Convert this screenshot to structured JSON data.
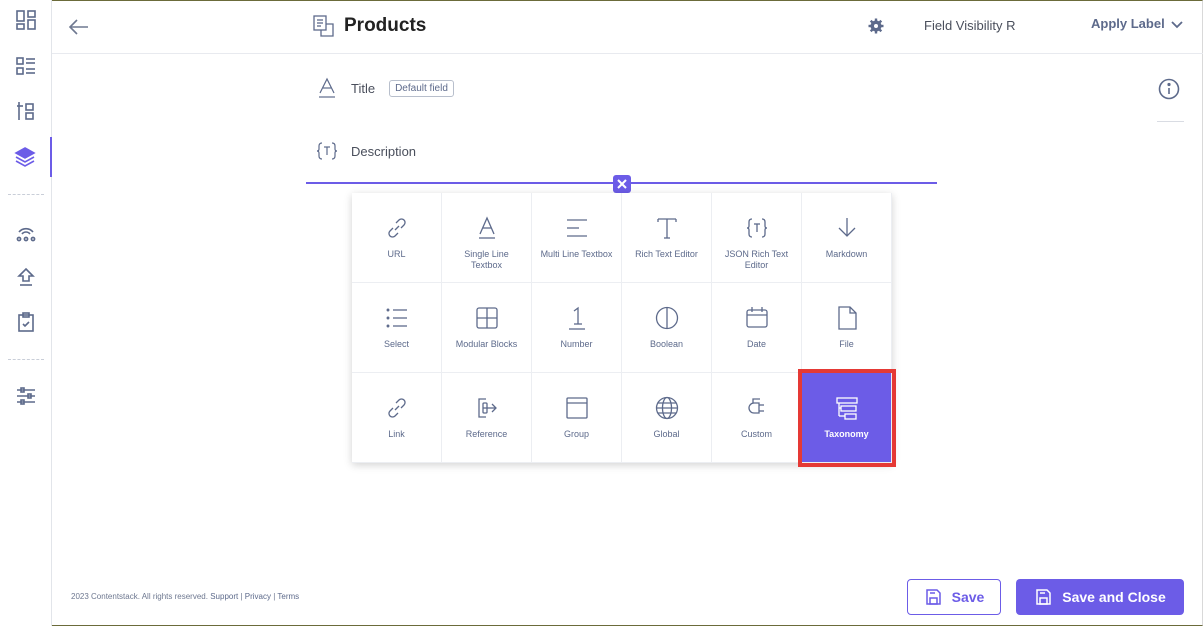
{
  "header": {
    "title": "Products",
    "visibility_text": "Field Visibility R",
    "apply_label": "Apply Label"
  },
  "fields": [
    {
      "label": "Title",
      "badge": "Default field",
      "icon": "text-a-icon"
    },
    {
      "label": "Description",
      "icon": "json-braces-icon"
    }
  ],
  "picker": {
    "items": [
      {
        "label": "URL",
        "icon": "link-icon"
      },
      {
        "label": "Single Line Textbox",
        "icon": "text-a-icon"
      },
      {
        "label": "Multi Line Textbox",
        "icon": "multiline-icon"
      },
      {
        "label": "Rich Text Editor",
        "icon": "text-t-icon"
      },
      {
        "label": "JSON Rich Text Editor",
        "icon": "json-braces-icon"
      },
      {
        "label": "Markdown",
        "icon": "markdown-arrow-icon"
      },
      {
        "label": "Select",
        "icon": "list-icon"
      },
      {
        "label": "Modular Blocks",
        "icon": "grid-icon"
      },
      {
        "label": "Number",
        "icon": "number-icon"
      },
      {
        "label": "Boolean",
        "icon": "boolean-icon"
      },
      {
        "label": "Date",
        "icon": "calendar-icon"
      },
      {
        "label": "File",
        "icon": "file-icon"
      },
      {
        "label": "Link",
        "icon": "chain-link-icon"
      },
      {
        "label": "Reference",
        "icon": "reference-icon"
      },
      {
        "label": "Group",
        "icon": "folder-icon"
      },
      {
        "label": "Global",
        "icon": "globe-icon"
      },
      {
        "label": "Custom",
        "icon": "plug-icon"
      },
      {
        "label": "Taxonomy",
        "icon": "taxonomy-icon"
      }
    ],
    "selected": "Taxonomy"
  },
  "footer": {
    "copyright": "2023 Contentstack. All rights reserved.",
    "support": "Support",
    "privacy": "Privacy",
    "terms": "Terms",
    "separator": "|",
    "save_label": "Save",
    "save_close_label": "Save and Close"
  },
  "colors": {
    "accent": "#6c5ce7",
    "highlight": "#e53935",
    "icon": "#5d6a8b"
  }
}
